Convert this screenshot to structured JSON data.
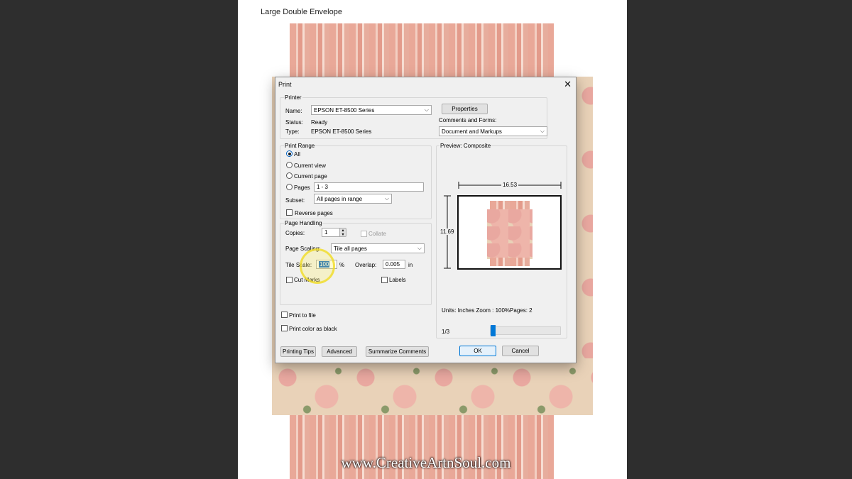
{
  "document": {
    "title": "Large Double Envelope"
  },
  "watermark": "www.CreativeArtnSoul.com",
  "colors": {
    "accent": "#0078d7",
    "dialog_bg": "#f0f0f0",
    "page_bg": "#2e2e2e"
  },
  "dialog": {
    "title": "Print",
    "printer": {
      "group_label": "Printer",
      "name_label": "Name:",
      "name_value": "EPSON ET-8500 Series",
      "status_label": "Status:",
      "status_value": "Ready",
      "type_label": "Type:",
      "type_value": "EPSON ET-8500 Series",
      "properties_button": "Properties",
      "comments_label": "Comments and Forms:",
      "comments_value": "Document and Markups"
    },
    "print_range": {
      "group_label": "Print Range",
      "all": "All",
      "current_view": "Current view",
      "current_page": "Current page",
      "pages": "Pages",
      "pages_value": "1 - 3",
      "subset_label": "Subset:",
      "subset_value": "All pages in range",
      "reverse_pages": "Reverse pages",
      "selected": "All"
    },
    "page_handling": {
      "group_label": "Page Handling",
      "copies_label": "Copies:",
      "copies_value": "1",
      "collate": "Collate",
      "scaling_label": "Page Scaling:",
      "scaling_value": "Tile all pages",
      "tile_scale_label": "Tile Scale:",
      "tile_scale_value": "100",
      "percent": "%",
      "overlap_label": "Overlap:",
      "overlap_value": "0.005",
      "unit": "in",
      "cut_marks": "Cut Marks",
      "labels": "Labels"
    },
    "print_to_file": "Print to file",
    "print_color_black": "Print color as black",
    "preview": {
      "label": "Preview: Composite",
      "width": "16.53",
      "height": "11.69",
      "units_text": "Units: Inches Zoom : 100%Pages: 2",
      "page_indicator": "1/3"
    },
    "buttons": {
      "printing_tips": "Printing Tips",
      "advanced": "Advanced",
      "summarize": "Summarize Comments",
      "ok": "OK",
      "cancel": "Cancel"
    }
  }
}
